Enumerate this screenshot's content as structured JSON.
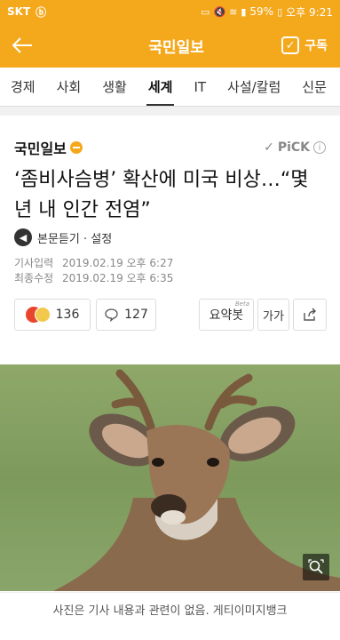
{
  "status": {
    "carrier": "SKT",
    "battery": "59%",
    "time": "오후 9:21"
  },
  "appbar": {
    "title": "국민일보",
    "subscribe_label": "구독"
  },
  "tabs": [
    {
      "label": "경제",
      "active": false
    },
    {
      "label": "사회",
      "active": false
    },
    {
      "label": "생활",
      "active": false
    },
    {
      "label": "세계",
      "active": true
    },
    {
      "label": "IT",
      "active": false
    },
    {
      "label": "사설/칼럼",
      "active": false
    },
    {
      "label": "신문",
      "active": false
    }
  ],
  "article": {
    "brand": "국민일보",
    "pick_label": "PiCK",
    "headline": "‘좀비사슴병’ 확산에 미국 비상…“몇년 내 인간 전염”",
    "listen_label": "본문듣기 · 설정",
    "input_label": "기사입력",
    "input_date": "2019.02.19 오후 6:27",
    "modified_label": "최종수정",
    "modified_date": "2019.02.19 오후 6:35"
  },
  "actions": {
    "reaction_count": "136",
    "comment_count": "127",
    "summary_label": "요약봇",
    "beta_label": "Beta",
    "font_label": "가가"
  },
  "photo": {
    "caption": "사진은 기사 내용과 관련이 없음. 게티이미지뱅크"
  },
  "colors": {
    "brand": "#f4a81c"
  }
}
